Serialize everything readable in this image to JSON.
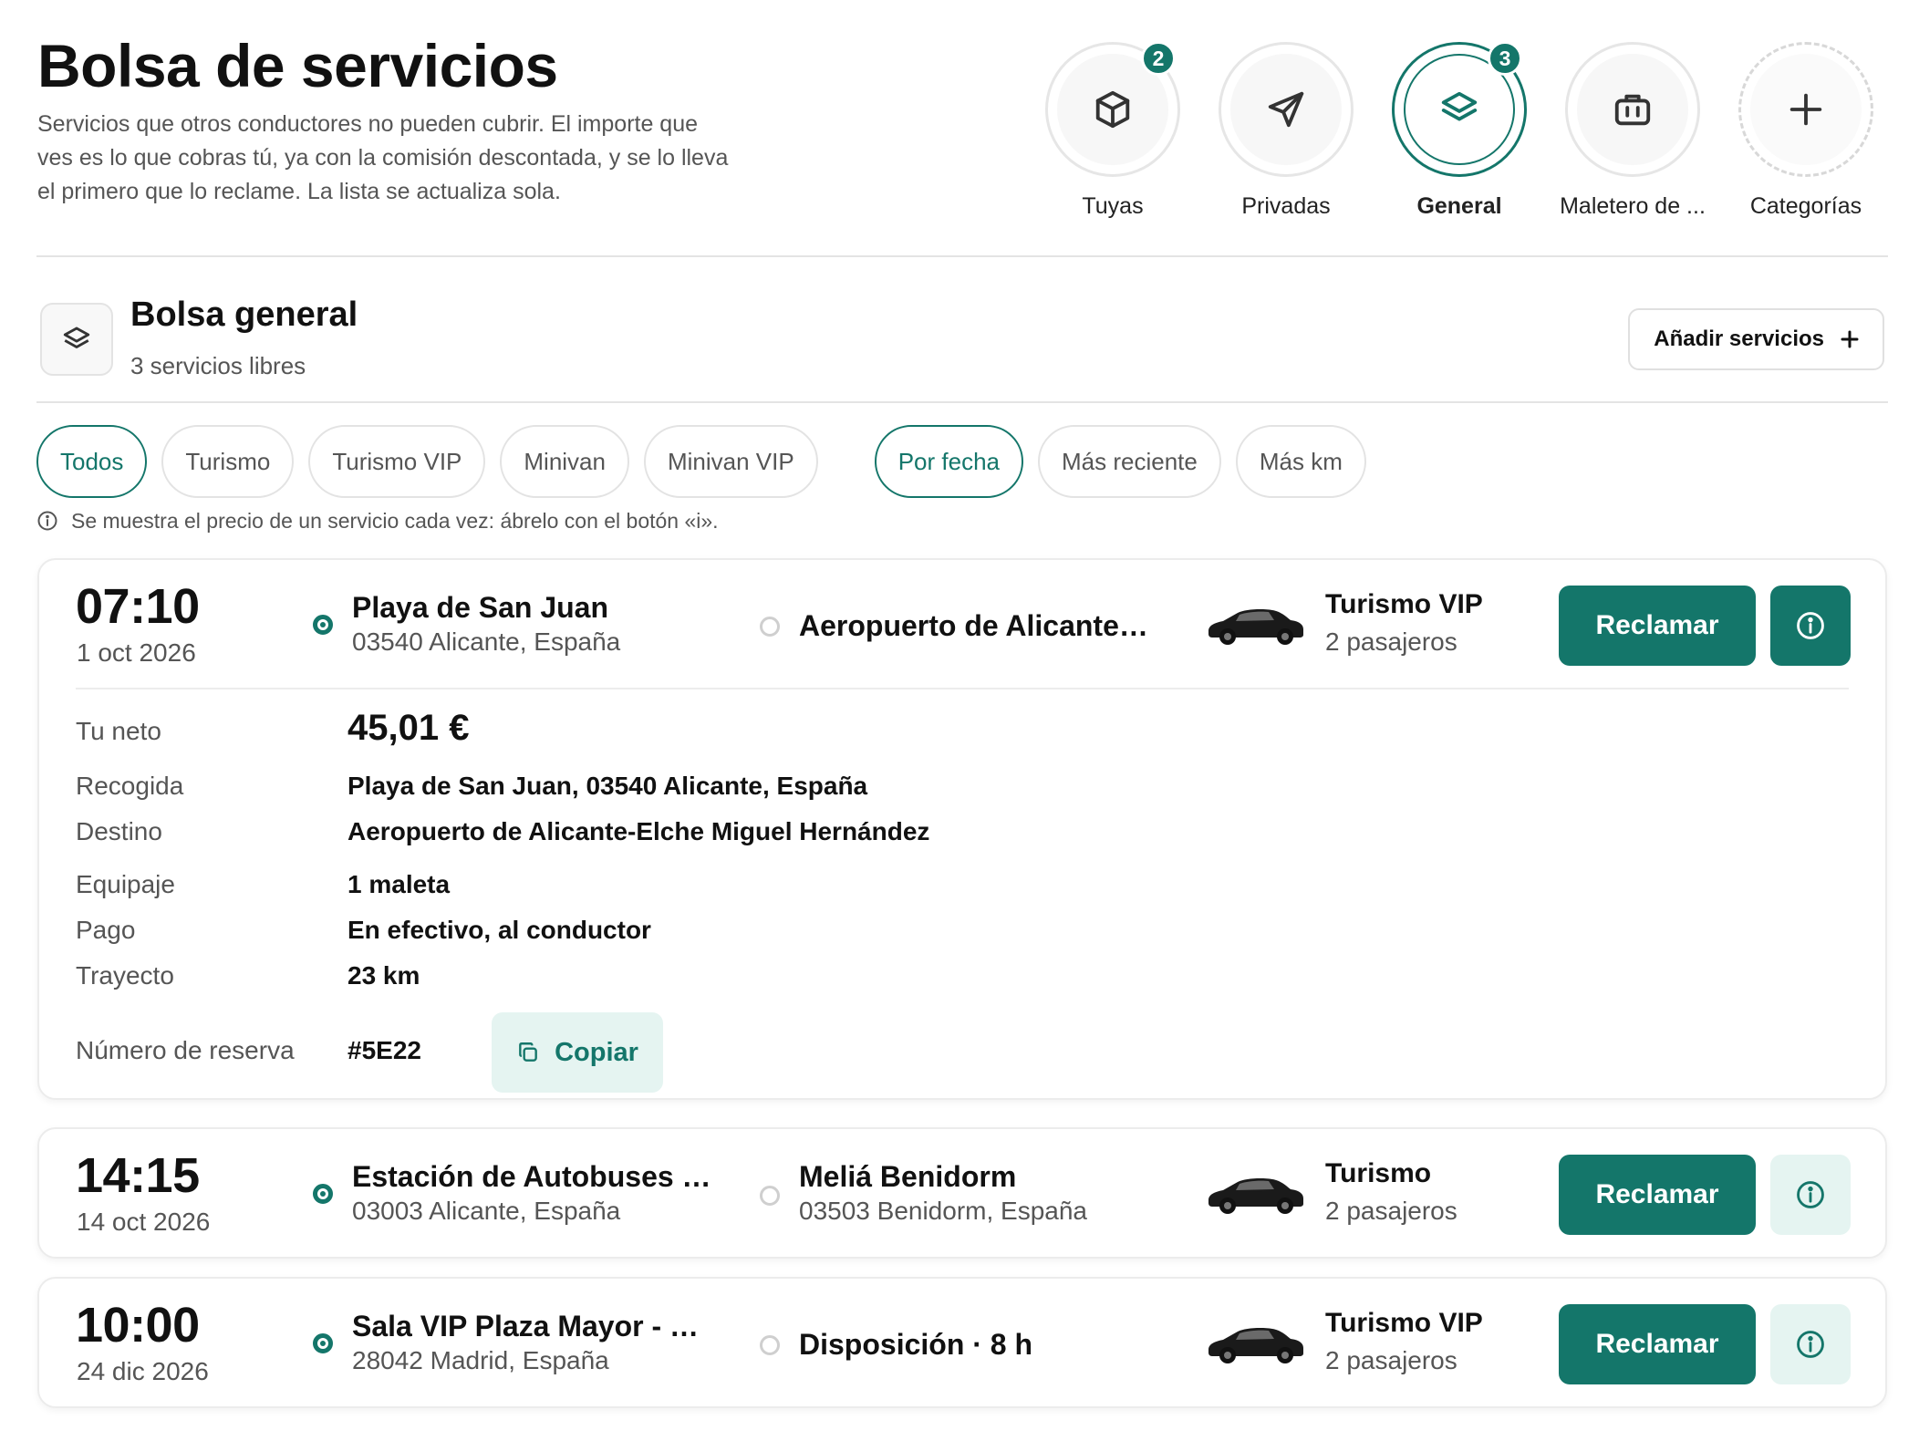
{
  "header": {
    "title": "Bolsa de servicios",
    "description": "Servicios que otros conductores no pueden cubrir. El importe que ves es lo que cobras tú, ya con la comisión descontada, y se lo lleva el primero que lo reclame. La lista se actualiza sola."
  },
  "categories": [
    {
      "label": "Tuyas",
      "badge": "2",
      "icon": "box-icon"
    },
    {
      "label": "Privadas",
      "badge": "",
      "icon": "send-icon"
    },
    {
      "label": "General",
      "badge": "3",
      "icon": "layers-icon",
      "active": true
    },
    {
      "label": "Maletero de ...",
      "badge": "",
      "icon": "briefcase-icon"
    },
    {
      "label": "Categorías",
      "badge": "",
      "icon": "plus-icon"
    }
  ],
  "section": {
    "title": "Bolsa general",
    "subtitle": "3 servicios libres",
    "add_label": "Añadir servicios"
  },
  "filters": {
    "vehicle": [
      "Todos",
      "Turismo",
      "Turismo VIP",
      "Minivan",
      "Minivan VIP"
    ],
    "vehicle_active": "Todos",
    "sort": [
      "Por fecha",
      "Más reciente",
      "Más km"
    ],
    "sort_active": "Por fecha"
  },
  "note": "Se muestra el precio de un servicio cada vez: ábrelo con el botón «i».",
  "services": [
    {
      "time": "07:10",
      "date": "1 oct 2026",
      "from_name": "Playa de San Juan",
      "from_addr": "03540 Alicante, España",
      "to_name": "Aeropuerto de Alicante…",
      "to_addr": "",
      "vehicle": "Turismo VIP",
      "passengers": "2 pasajeros",
      "claim_label": "Reclamar",
      "expanded": true,
      "details": {
        "net_label": "Tu neto",
        "net_value": "45,01 €",
        "pickup_label": "Recogida",
        "pickup_value": "Playa de San Juan, 03540 Alicante, España",
        "dest_label": "Destino",
        "dest_value": "Aeropuerto de Alicante-Elche Miguel Hernández",
        "luggage_label": "Equipaje",
        "luggage_value": "1 maleta",
        "payment_label": "Pago",
        "payment_value": "En efectivo, al conductor",
        "route_label": "Trayecto",
        "route_value": "23 km",
        "booking_label": "Número de reserva",
        "booking_value": "#5E22",
        "copy_label": "Copiar"
      }
    },
    {
      "time": "14:15",
      "date": "14 oct 2026",
      "from_name": "Estación de Autobuses …",
      "from_addr": "03003 Alicante, España",
      "to_name": "Meliá Benidorm",
      "to_addr": "03503 Benidorm, España",
      "vehicle": "Turismo",
      "passengers": "2 pasajeros",
      "claim_label": "Reclamar",
      "expanded": false
    },
    {
      "time": "10:00",
      "date": "24 dic 2026",
      "from_name": "Sala VIP Plaza Mayor - …",
      "from_addr": "28042 Madrid, España",
      "to_name": "Disposición · 8 h",
      "to_addr": "",
      "vehicle": "Turismo VIP",
      "passengers": "2 pasajeros",
      "claim_label": "Reclamar",
      "expanded": false
    }
  ],
  "colors": {
    "accent": "#14766a",
    "accent_light": "#e5f4f1"
  }
}
